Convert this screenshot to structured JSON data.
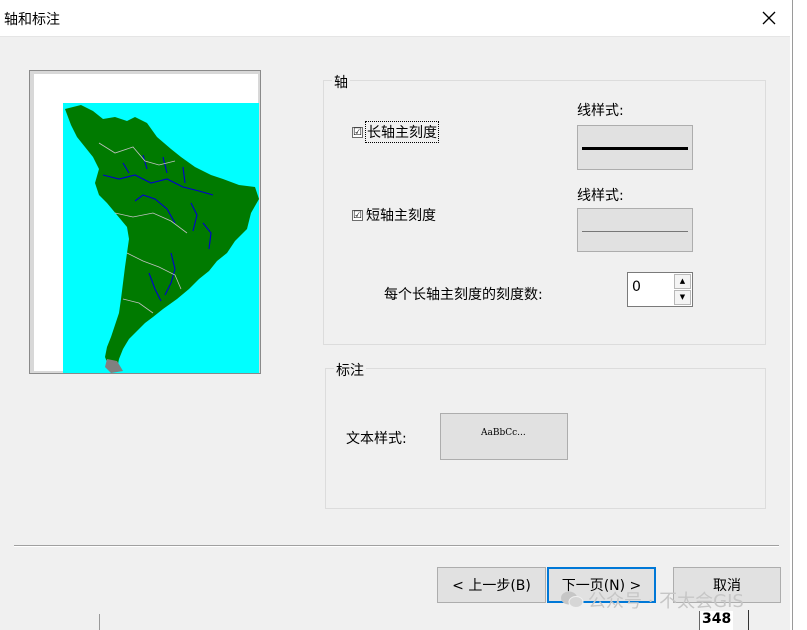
{
  "window": {
    "title": "轴和标注"
  },
  "axis_group": {
    "label": "轴",
    "major_tick": {
      "label": "长轴主刻度",
      "checked": true,
      "line_style_label": "线样式:"
    },
    "minor_tick": {
      "label": "短轴主刻度",
      "checked": true,
      "line_style_label": "线样式:"
    },
    "ticks_per_major": {
      "label": "每个长轴主刻度的刻度数:",
      "value": "0"
    }
  },
  "annotation_group": {
    "label": "标注",
    "text_style_label": "文本样式:",
    "text_style_sample": "AaBbCc..."
  },
  "buttons": {
    "back": "< 上一步(B)",
    "next": "下一页(N) >",
    "cancel": "取消"
  },
  "watermark": {
    "text": "公众号 · 不太会GIS"
  },
  "background": {
    "number": "348"
  },
  "colors": {
    "ocean": "#00ffff",
    "land": "#007a00",
    "rivers": "#0000cc",
    "borders": "#c0c0c0",
    "accent": "#0078d7"
  },
  "icons": {
    "check": "☑",
    "close": "close-icon",
    "spin_up": "▲",
    "spin_down": "▼"
  }
}
